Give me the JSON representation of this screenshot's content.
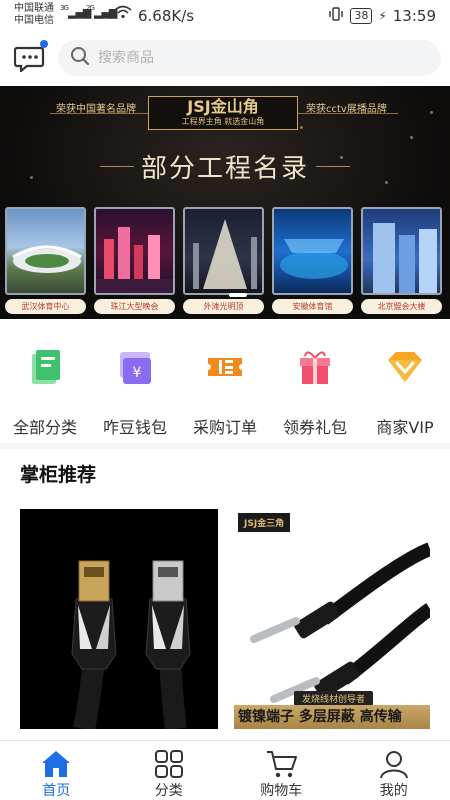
{
  "status_bar": {
    "carrier1": "中国联通",
    "carrier2": "中国电信",
    "net1": "3G",
    "net2": "2G",
    "speed": "6.68K/s",
    "battery": "38",
    "time": "13:59"
  },
  "search": {
    "placeholder": "搜索商品"
  },
  "banner": {
    "left_text": "荣获中国著名品牌",
    "right_text": "荣获cctv展播品牌",
    "logo": "JSJ金山角",
    "logo_sub": "工程界主角 就选金山角",
    "title": "部分工程名录",
    "cards": [
      {
        "caption": "武汉体育中心"
      },
      {
        "caption": "珠江大型晚会"
      },
      {
        "caption": "外滩光明顶"
      },
      {
        "caption": "安徽体育馆"
      },
      {
        "caption": "北京盟会大楼"
      }
    ]
  },
  "quick_menu": [
    {
      "label": "全部分类",
      "icon": "book-icon",
      "color": "#3ec26b"
    },
    {
      "label": "咋豆钱包",
      "icon": "wallet-icon",
      "color": "#8a6cf0"
    },
    {
      "label": "采购订单",
      "icon": "ticket-icon",
      "color": "#f08a1c"
    },
    {
      "label": "领券礼包",
      "icon": "gift-icon",
      "color": "#f0506e"
    },
    {
      "label": "商家VIP",
      "icon": "vip-diamond-icon",
      "color": "#f5a623"
    }
  ],
  "section": {
    "title": "掌柜推荐"
  },
  "products": [
    {
      "name": "hdmi-cable"
    },
    {
      "brand": "JSJ金三角",
      "tag": "发烧线材创导者",
      "banner": "镀镍端子 多层屏蔽 高传输"
    }
  ],
  "tabs": [
    {
      "label": "首页",
      "icon": "home-icon",
      "active": true
    },
    {
      "label": "分类",
      "icon": "category-grid-icon",
      "active": false
    },
    {
      "label": "购物车",
      "icon": "cart-icon",
      "active": false
    },
    {
      "label": "我的",
      "icon": "user-icon",
      "active": false
    }
  ],
  "colors": {
    "accent": "#1e6fe6",
    "banner_gold": "#e8c98a"
  }
}
